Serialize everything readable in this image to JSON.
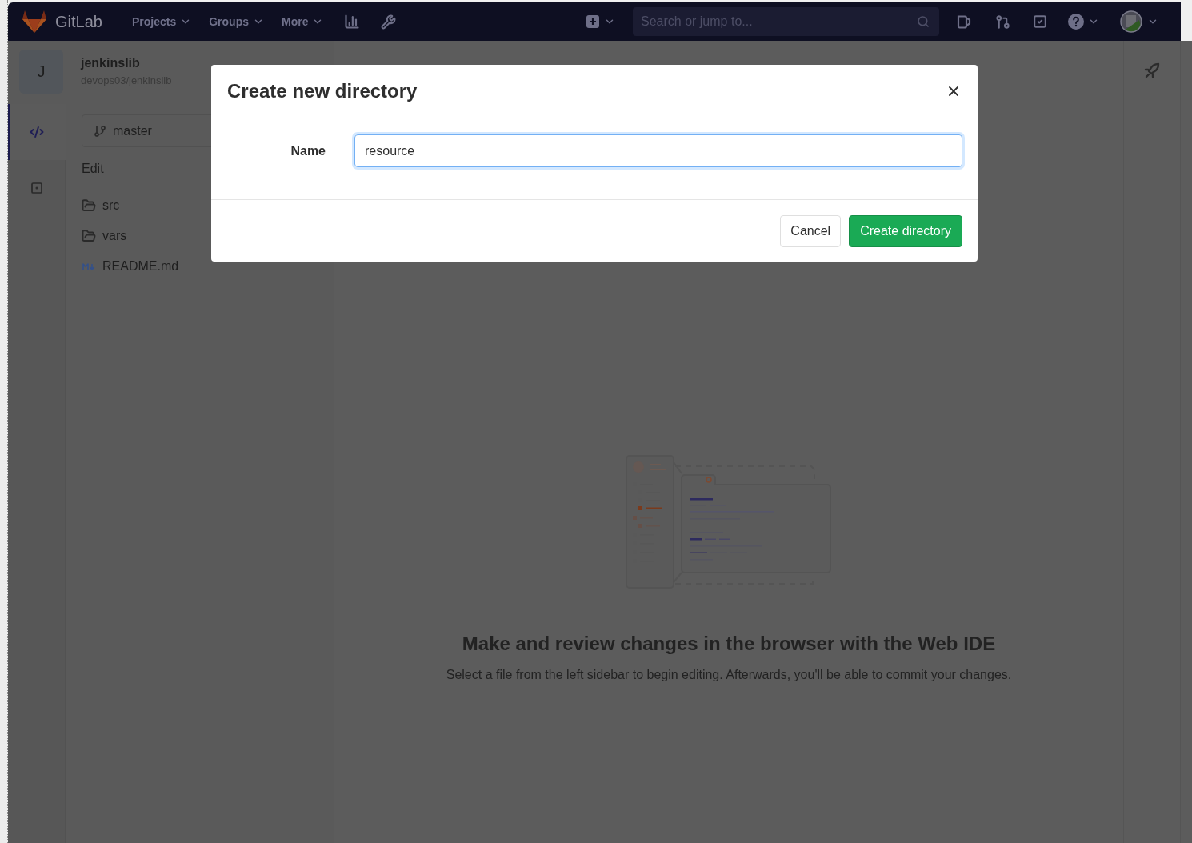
{
  "navbar": {
    "brand": "GitLab",
    "menus": [
      {
        "label": "Projects"
      },
      {
        "label": "Groups"
      },
      {
        "label": "More"
      }
    ],
    "search": {
      "placeholder": "Search or jump to..."
    }
  },
  "project": {
    "initial": "J",
    "name": "jenkinslib",
    "path": "devops03/jenkinslib"
  },
  "activity_bar": [
    {
      "kind": "code",
      "selected": true
    },
    {
      "kind": "commit",
      "selected": false
    }
  ],
  "file_panel": {
    "branch": "master",
    "heading": "Edit",
    "files": [
      {
        "kind": "folder",
        "name": "src"
      },
      {
        "kind": "folder",
        "name": "vars"
      },
      {
        "kind": "markdown",
        "name": "README.md"
      }
    ]
  },
  "empty_state": {
    "title": "Make and review changes in the browser with the Web IDE",
    "description": "Select a file from the left sidebar to begin editing. Afterwards, you'll be able to commit your changes."
  },
  "dialog": {
    "title": "Create new directory",
    "field": {
      "label": "Name",
      "value": "resource",
      "focused": true
    },
    "buttons": [
      {
        "kind": "secondary",
        "label": "Cancel"
      },
      {
        "kind": "primary",
        "label": "Create directory"
      }
    ]
  }
}
